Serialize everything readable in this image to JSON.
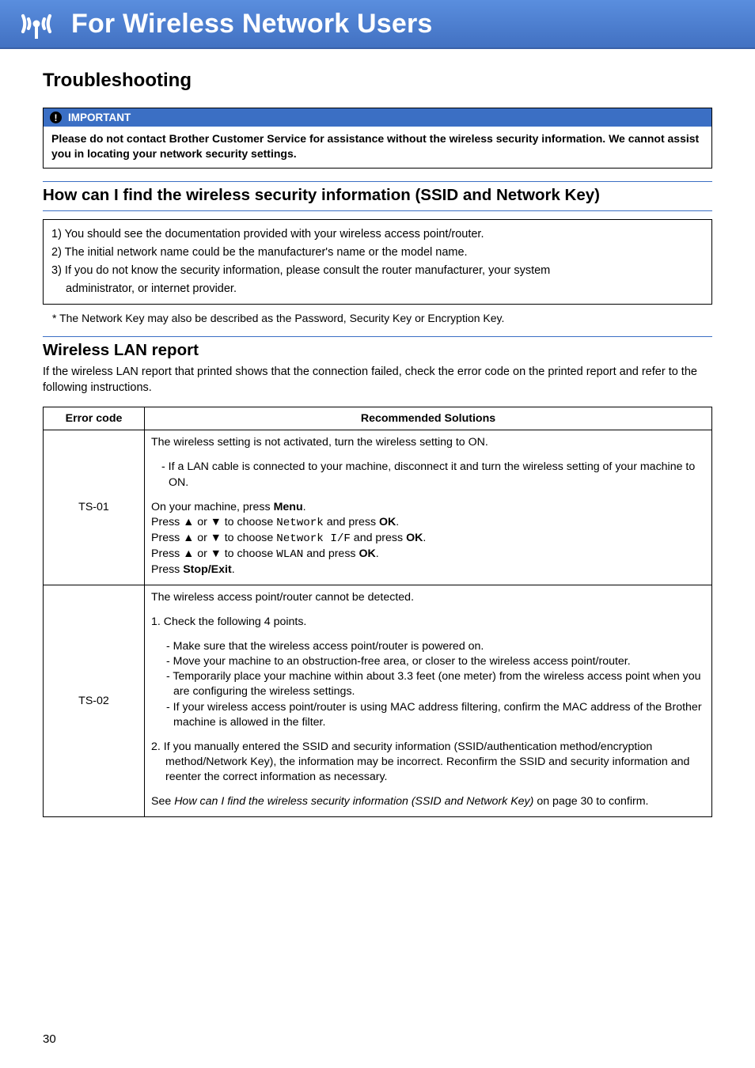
{
  "banner": {
    "title": "For Wireless Network Users"
  },
  "heading": "Troubleshooting",
  "important": {
    "label": "IMPORTANT",
    "body": "Please do not contact Brother Customer Service for assistance without the wireless security information. We cannot assist you in locating your network security settings."
  },
  "section1": {
    "title": "How can I find the wireless security information (SSID and Network Key)",
    "steps": [
      "1) You should see the documentation provided with your wireless access point/router.",
      "2) The initial network name could be the manufacturer's name or the model name.",
      "3) If you do not know the security information, please consult the router manufacturer, your system"
    ],
    "step3_cont": "administrator, or internet provider.",
    "footnote": "* The Network Key may also be described as the Password, Security Key or Encryption Key."
  },
  "section2": {
    "title": "Wireless LAN report",
    "intro": "If the wireless LAN report that printed shows that the connection failed, check the error code on the printed report and refer to the following instructions."
  },
  "table": {
    "col1": "Error code",
    "col2": "Recommended Solutions",
    "rows": [
      {
        "code": "TS-01",
        "sol": {
          "p1": "The wireless setting is not activated, turn the wireless setting to ON.",
          "p2": "- If a LAN cable is connected to your machine, disconnect it and turn the wireless setting of your machine to ON.",
          "l1a": "On your machine, press ",
          "l1b": "Menu",
          "l1c": ".",
          "l2a": "Press ▲ or ▼ to choose ",
          "l2b": "Network",
          "l2c": " and press ",
          "l2d": "OK",
          "l2e": ".",
          "l3a": "Press ▲ or ▼ to choose ",
          "l3b": "Network I/F",
          "l3c": " and press ",
          "l3d": "OK",
          "l3e": ".",
          "l4a": "Press ▲ or ▼ to choose ",
          "l4b": "WLAN",
          "l4c": " and press ",
          "l4d": "OK",
          "l4e": ".",
          "l5a": "Press ",
          "l5b": "Stop/Exit",
          "l5c": "."
        }
      },
      {
        "code": "TS-02",
        "sol": {
          "p1": "The wireless access point/router cannot be detected.",
          "p2": "1. Check the following 4 points.",
          "b1": "- Make sure that the wireless access point/router is powered on.",
          "b2": "- Move your machine to an obstruction-free area, or closer to the wireless access point/router.",
          "b3": "- Temporarily place your machine within about 3.3 feet (one meter) from the wireless access point when you are configuring the wireless settings.",
          "b4": "- If your wireless access point/router is using MAC address filtering, confirm the MAC address of the Brother machine is allowed in the filter.",
          "p3": "2. If you manually entered the SSID and security information (SSID/authentication method/encryption method/Network Key), the information may be incorrect. Reconfirm the SSID and security information and reenter the correct information as necessary.",
          "p4a": "See ",
          "p4b": "How can I find the wireless security information (SSID and Network Key)",
          "p4c": " on page 30 to confirm."
        }
      }
    ]
  },
  "page_number": "30"
}
